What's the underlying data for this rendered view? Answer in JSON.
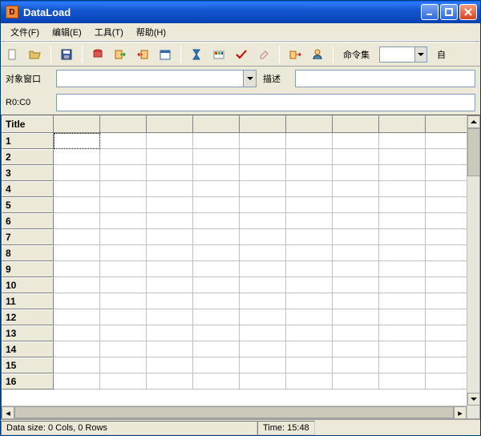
{
  "window": {
    "title": "DataLoad"
  },
  "menu": {
    "file": "文件(F)",
    "edit": "编辑(E)",
    "tools": "工具(T)",
    "help": "帮助(H)"
  },
  "toolbar": {
    "cmdset_label": "命令集",
    "auto_label": "自"
  },
  "form": {
    "target_window_label": "对象窗口",
    "target_window_value": "",
    "desc_label": "描述",
    "desc_value": "",
    "cursor_label": "R0:C0",
    "cursor_value": ""
  },
  "grid": {
    "title_header": "Title",
    "rows": [
      1,
      2,
      3,
      4,
      5,
      6,
      7,
      8,
      9,
      10,
      11,
      12,
      13,
      14,
      15,
      16
    ],
    "colCount": 9
  },
  "status": {
    "data_size": "Data size: 0 Cols, 0 Rows",
    "time": "Time: 15:48"
  }
}
